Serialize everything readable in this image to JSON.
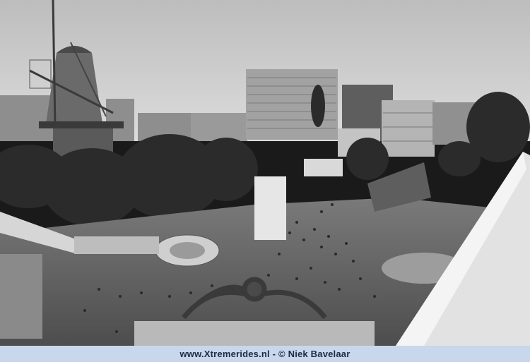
{
  "image": {
    "description_kind": "black-and-white photograph of a crowded fairground with a windmill and city buildings",
    "palette": {
      "sky": "#c9c9c9",
      "buildings": "#8a8a8a",
      "trees": "#2e2e2e",
      "ground": "#6f6f6f",
      "ride_white": "#e6e6e6",
      "caption_bar": "#c8d7ec",
      "caption_text": "#1f2b44"
    }
  },
  "caption": {
    "text": "www.Xtremerides.nl - © Niek Bavelaar"
  }
}
